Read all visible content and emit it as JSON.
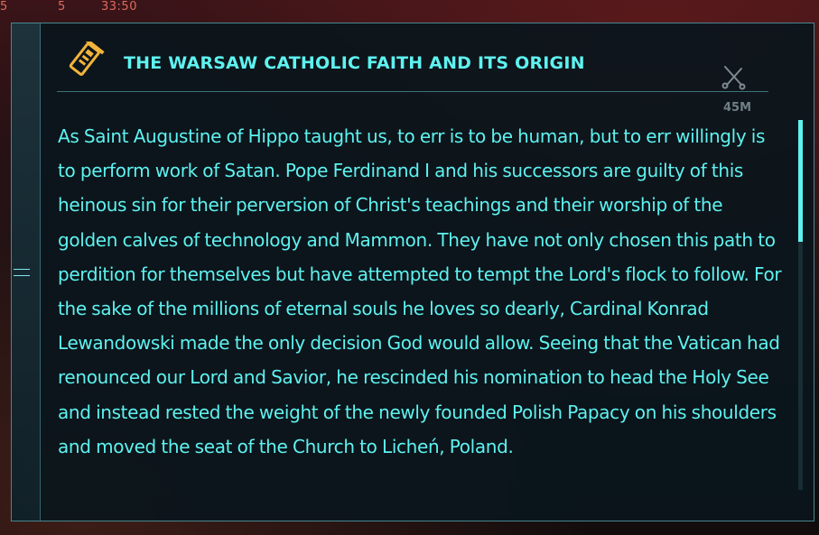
{
  "hud": {
    "left_num": "5",
    "mid_num": "5",
    "timer": "33:50"
  },
  "shard": {
    "title": "THE WARSAW CATHOLIC FAITH AND ITS ORIGIN",
    "size_label": "45M",
    "header_icon": "shard-chip-icon",
    "tool_icon": "crossed-tools-icon",
    "body": "As Saint Augustine of Hippo taught us, to err is to be human, but to err willingly is to perform work of Satan. Pope Ferdinand I and his successors are guilty of this heinous sin for their perversion of Christ's teachings and their worship of the golden calves of technology and Mammon. They have not only chosen this path to perdition for themselves but have attempted to tempt the Lord's flock to follow. For the sake of the millions of eternal souls he loves so dearly, Cardinal Konrad Lewandowski made the only decision God would allow. Seeing that the Vatican had renounced our Lord and Savior, he rescinded his nomination to head the Holy See and instead rested the weight of the newly founded Polish Papacy on his shoulders and moved the seat of the Church to Licheń, Poland."
  },
  "colors": {
    "accent": "#5ef2f0",
    "panel_bg": "#0a161c",
    "header_icon": "#f2b43a",
    "hud_red": "#e06a5e",
    "muted": "#6f7f86"
  },
  "scroll": {
    "position_fraction": 0.0,
    "visible_fraction": 0.33
  }
}
